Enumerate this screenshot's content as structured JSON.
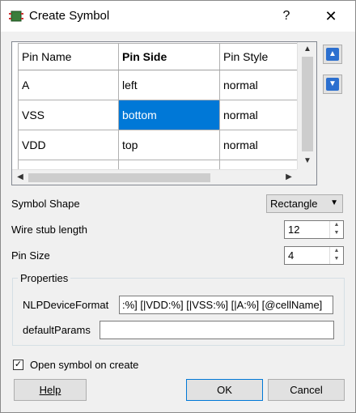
{
  "window": {
    "title": "Create Symbol",
    "help_glyph": "?",
    "close_glyph": "✕"
  },
  "pin_table": {
    "columns": [
      "Pin Name",
      "Pin Side",
      "Pin Style"
    ],
    "rows": [
      {
        "name": "A",
        "side": "left",
        "style": "normal"
      },
      {
        "name": "VSS",
        "side": "bottom",
        "style": "normal"
      },
      {
        "name": "VDD",
        "side": "top",
        "style": "normal"
      }
    ],
    "selected_row": 1,
    "selected_col": "Pin Side"
  },
  "move_buttons": {
    "up_icon": "arrow-up-icon",
    "down_icon": "arrow-down-icon"
  },
  "symbol_shape": {
    "label": "Symbol Shape",
    "value": "Rectangle"
  },
  "wire_stub": {
    "label": "Wire stub length",
    "value": "12"
  },
  "pin_size": {
    "label": "Pin Size",
    "value": "4"
  },
  "properties": {
    "title": "Properties",
    "nlp_label": "NLPDeviceFormat",
    "nlp_value": ":%] [|VDD:%] [|VSS:%] [|A:%] [@cellName]",
    "default_label": "defaultParams",
    "default_value": ""
  },
  "open_on_create": {
    "label": "Open symbol on create",
    "checked": true
  },
  "buttons": {
    "help": "Help",
    "ok": "OK",
    "cancel": "Cancel"
  },
  "colors": {
    "selection": "#0078d7",
    "arrow_buttons": "#2b6fcf"
  }
}
